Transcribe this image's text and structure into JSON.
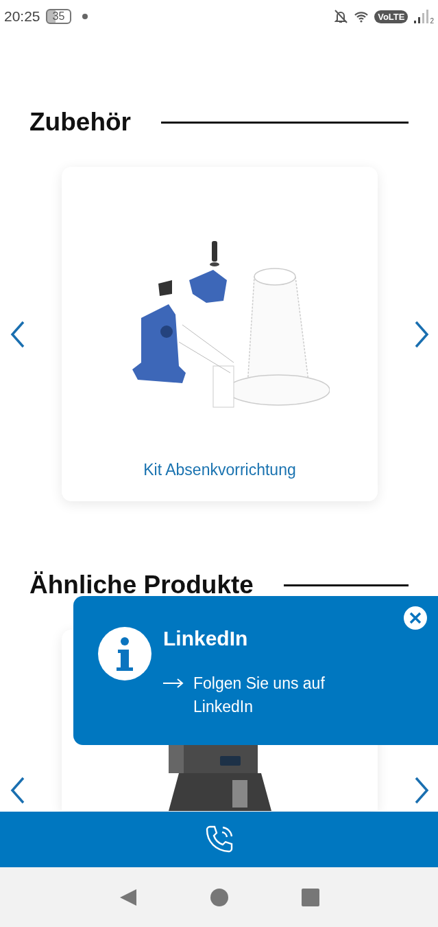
{
  "status_bar": {
    "time": "20:25",
    "battery": "35",
    "network": "VoLTE",
    "sim": "2"
  },
  "sections": [
    {
      "title": "Zubehör",
      "card": {
        "kind": "picture",
        "label": "Kit Absenkvorrichtung"
      }
    },
    {
      "title": "Ähnliche Produkte"
    }
  ],
  "popup": {
    "title": "LinkedIn",
    "link": "Folgen Sie uns auf LinkedIn"
  }
}
